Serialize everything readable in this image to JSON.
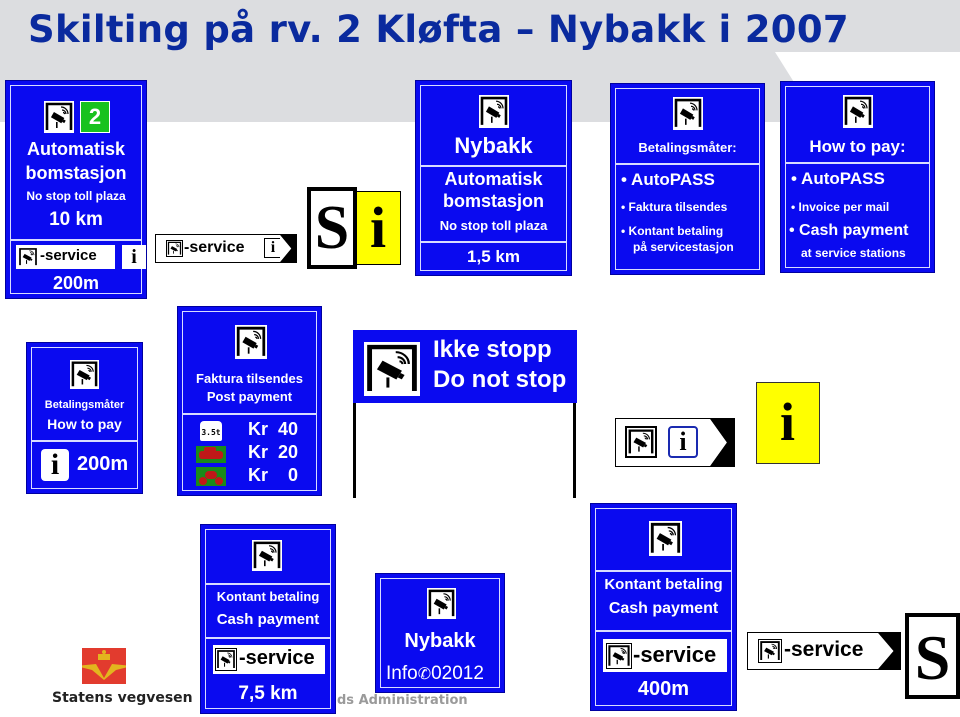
{
  "page": {
    "title": "Skilting på rv. 2 Kløfta – Nybakk i 2007"
  },
  "colors": {
    "sign_blue": "#0a0af0",
    "title_blue": "#0a2a9e",
    "green_badge": "#18c21e",
    "yellow_info": "#ffff00",
    "logo_red": "#e23b2e",
    "logo_gold": "#e3b51e"
  },
  "icons": {
    "toll_camera": "toll-camera-icon",
    "info": "info-icon",
    "phone": "phone-icon",
    "truck": "truck-icon",
    "car": "car-icon",
    "motorcycle": "motorcycle-icon",
    "arrow": "arrow-right-icon"
  },
  "signs": {
    "toll_10km": {
      "route_number": "2",
      "line1": "Automatisk",
      "line2": "bomstasjon",
      "line3": "No stop toll plaza",
      "distance": "10 km",
      "service_label": "-service",
      "info_glyph": "i",
      "service_distance": "200m"
    },
    "service_arrow": {
      "label": "-service",
      "info_glyph": "i"
    },
    "si_sign": {
      "s": "S",
      "i": "i"
    },
    "nybakk_toll": {
      "place": "Nybakk",
      "line1": "Automatisk",
      "line2": "bomstasjon",
      "line3": "No stop toll plaza",
      "distance": "1,5 km"
    },
    "betalingsmater": {
      "heading": "Betalingsmåter:",
      "items": [
        "AutoPASS",
        "Faktura tilsendes",
        "Kontant betaling",
        "på servicestasjon"
      ]
    },
    "how_to_pay": {
      "heading": "How to pay:",
      "items": [
        "AutoPASS",
        "Invoice per mail",
        "Cash payment",
        "at service stations"
      ]
    },
    "how_to_pay_200m": {
      "line1": "Betalingsmåter",
      "line2": "How to pay",
      "info_glyph": "i",
      "distance": "200m"
    },
    "post_payment": {
      "line1": "Faktura tilsendes",
      "line2": "Post payment",
      "truck_label": "3.5t",
      "rates": [
        {
          "vehicle": "truck",
          "price": "Kr  40"
        },
        {
          "vehicle": "car",
          "price": "Kr  20"
        },
        {
          "vehicle": "motorcycle",
          "price": "Kr    0"
        }
      ]
    },
    "do_not_stop": {
      "line1": "Ikke stopp",
      "line2": "Do not stop"
    },
    "service_arrow_info": {
      "info_glyph": "i"
    },
    "yellow_info": {
      "glyph": "i"
    },
    "cash_7_5km": {
      "line1": "Kontant betaling",
      "line2": "Cash payment",
      "service_label": "-service",
      "distance": "7,5 km"
    },
    "nybakk_info": {
      "place": "Nybakk",
      "info_label": "Info",
      "phone": "02012"
    },
    "cash_400m": {
      "line1": "Kontant betaling",
      "line2": "Cash payment",
      "service_label": "-service",
      "distance": "400m"
    },
    "service_arrow_2": {
      "label": "-service"
    },
    "s_sign": {
      "s": "S"
    }
  },
  "footer": {
    "logo_text": "Statens vegvesen",
    "watermark": "ds Administration"
  }
}
